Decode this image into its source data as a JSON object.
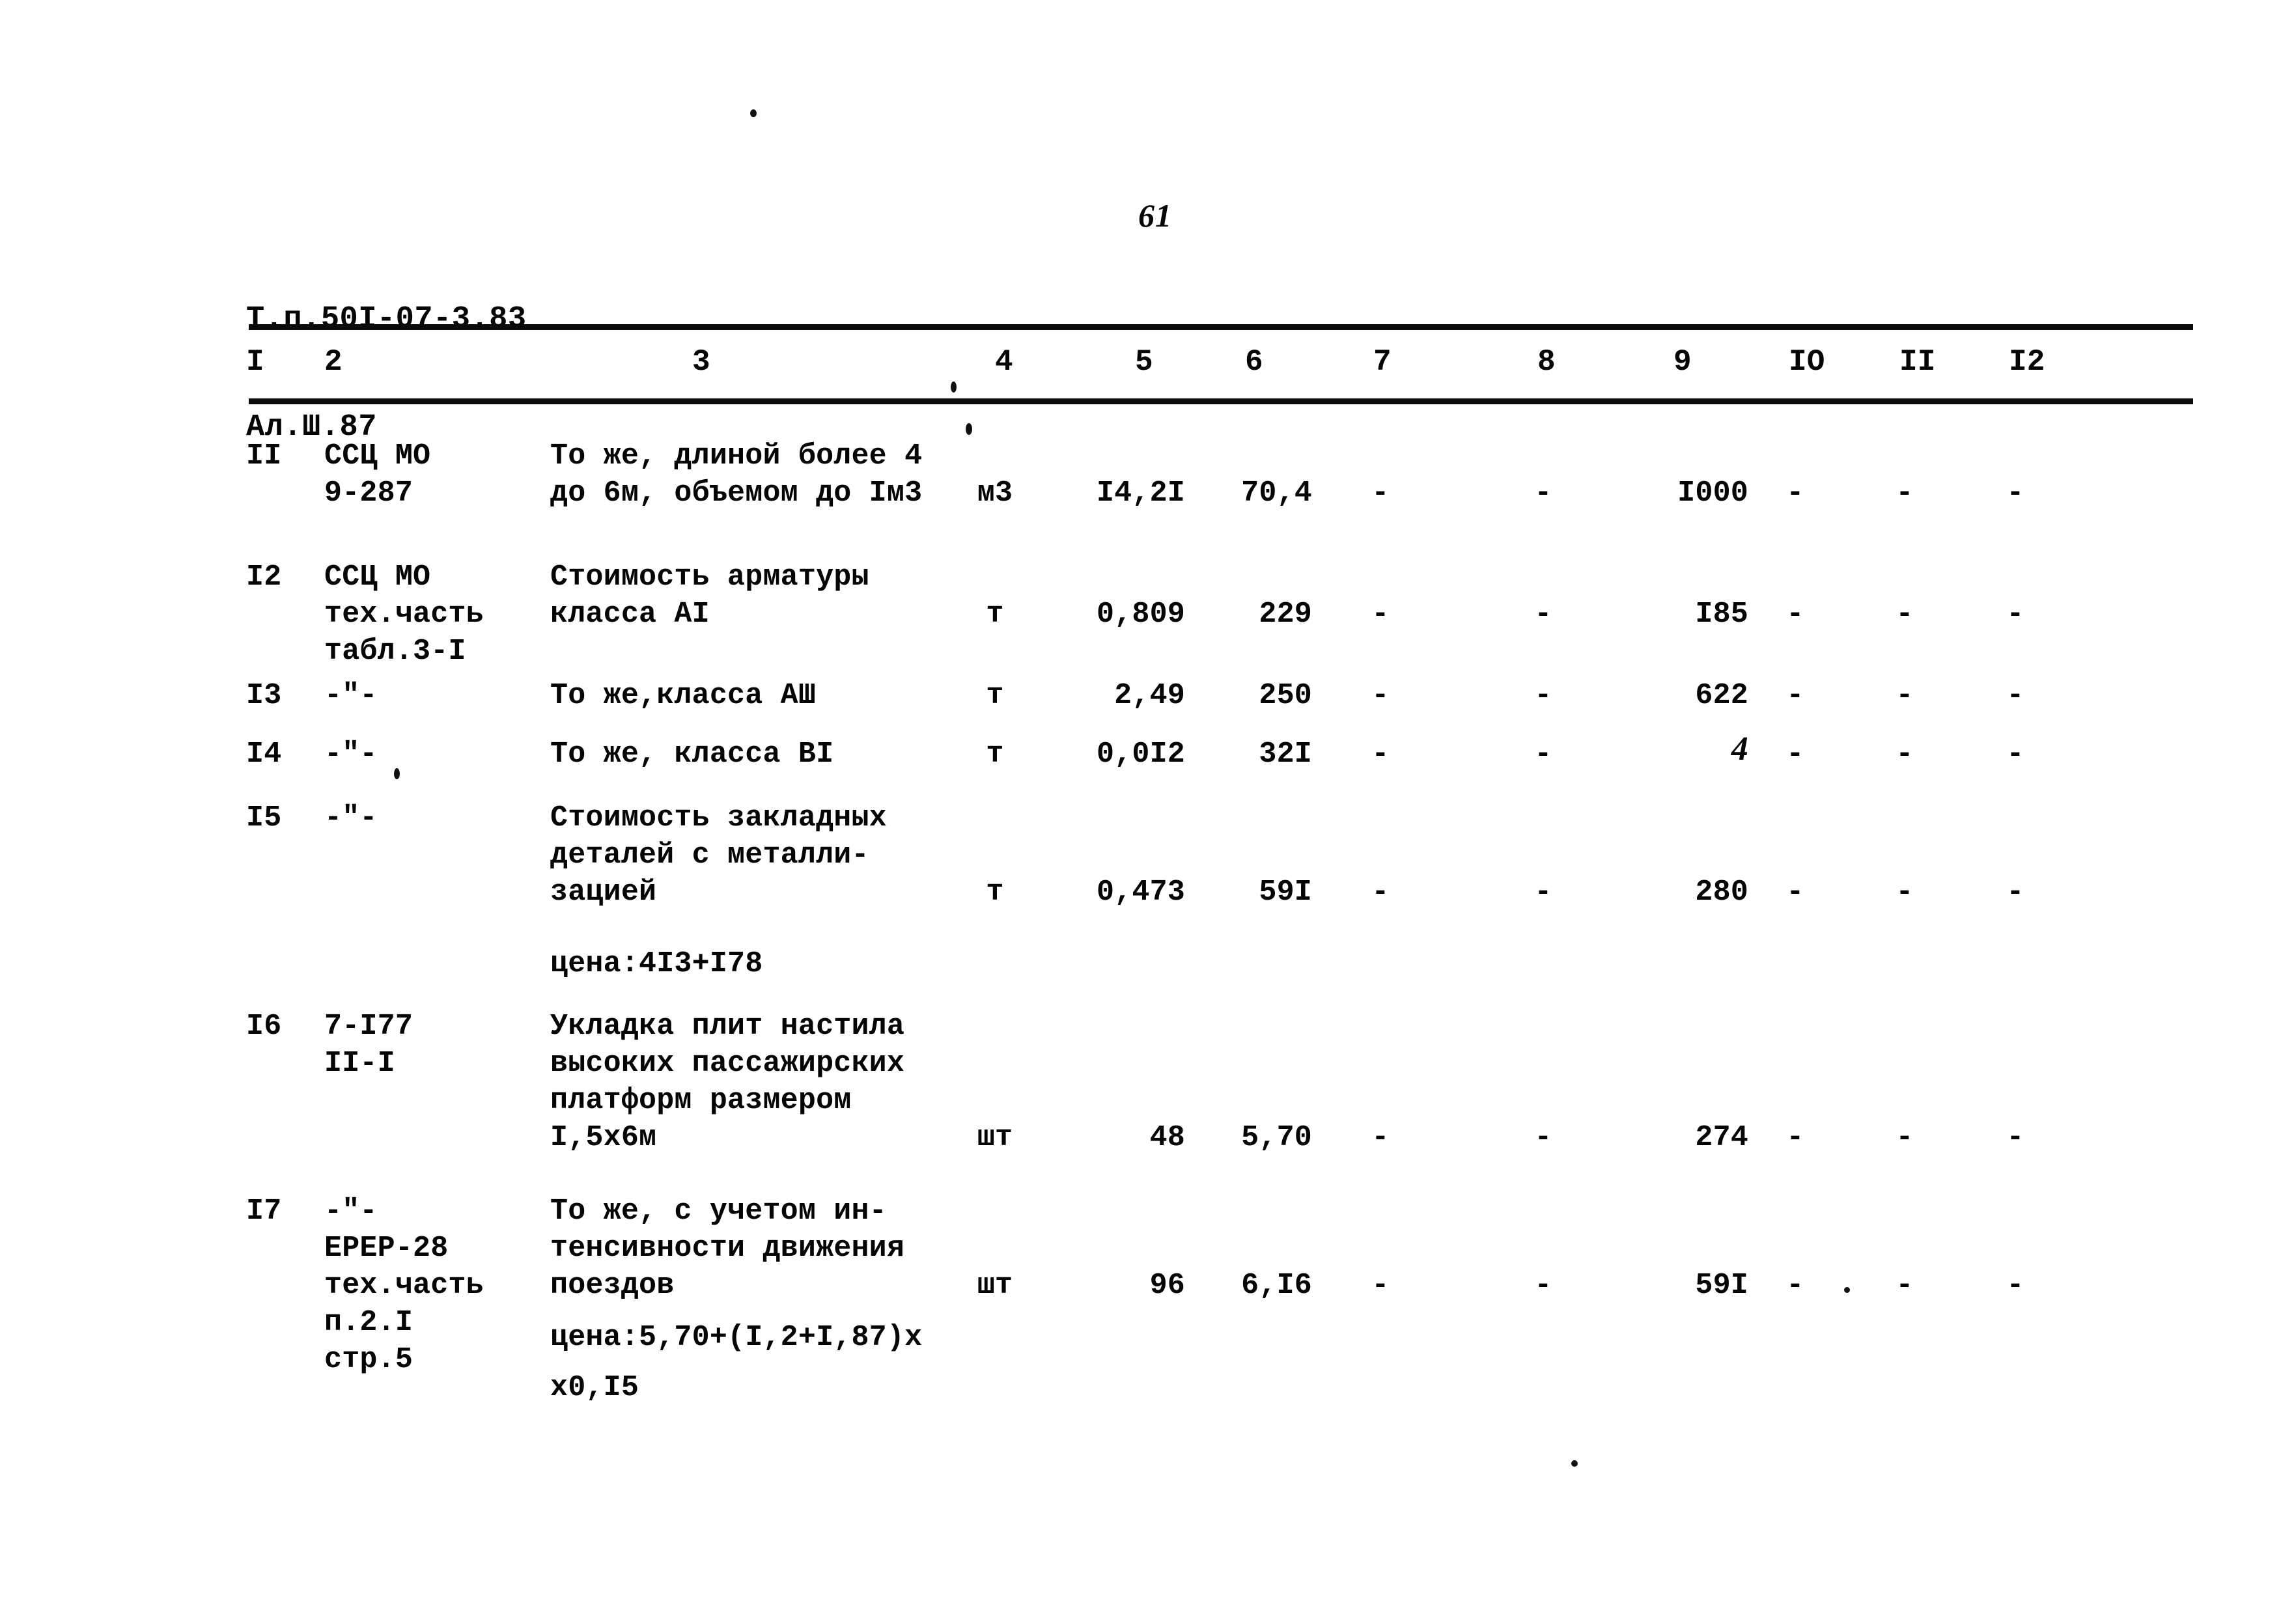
{
  "document": {
    "code_line1": "Т.п.50I-07-3.83",
    "code_line2": "Ал.Ш.87",
    "page_number": "61"
  },
  "table": {
    "column_headers": [
      "I",
      "2",
      "3",
      "4",
      "5",
      "6",
      "7",
      "8",
      "9",
      "IO",
      "II",
      "I2"
    ],
    "rows": [
      {
        "num": "II",
        "code": [
          "ССЦ МО",
          "9-287"
        ],
        "description": [
          "То же, длиной более 4",
          "до 6м, объемом до Iм3"
        ],
        "note": "",
        "unit": "м3",
        "qty": "I4,2I",
        "price": "70,4",
        "c7": "-",
        "c8": "-",
        "total": "I000",
        "c10": "-",
        "c11": "-",
        "c12": "-"
      },
      {
        "num": "I2",
        "code": [
          "ССЦ МО",
          "тех.часть",
          "табл.3-I"
        ],
        "description": [
          "Стоимость арматуры",
          "класса АI"
        ],
        "note": "",
        "unit": "т",
        "qty": "0,809",
        "price": "229",
        "c7": "-",
        "c8": "-",
        "total": "I85",
        "c10": "-",
        "c11": "-",
        "c12": "-"
      },
      {
        "num": "I3",
        "code": [
          "-\"-"
        ],
        "description": [
          "То же,класса АШ"
        ],
        "note": "",
        "unit": "т",
        "qty": "2,49",
        "price": "250",
        "c7": "-",
        "c8": "-",
        "total": "622",
        "c10": "-",
        "c11": "-",
        "c12": "-"
      },
      {
        "num": "I4",
        "code": [
          "-\"-"
        ],
        "description": [
          "То же, класса ВI"
        ],
        "note": "",
        "unit": "т",
        "qty": "0,0I2",
        "price": "32I",
        "c7": "-",
        "c8": "-",
        "total": "4",
        "c10": "-",
        "c11": "-",
        "c12": "-"
      },
      {
        "num": "I5",
        "code": [
          "-\"-"
        ],
        "description": [
          "Стоимость закладных",
          "деталей с металли-",
          "зацией"
        ],
        "note": "цена:4I3+I78",
        "unit": "т",
        "qty": "0,473",
        "price": "59I",
        "c7": "-",
        "c8": "-",
        "total": "280",
        "c10": "-",
        "c11": "-",
        "c12": "-"
      },
      {
        "num": "I6",
        "code": [
          "7-I77",
          "II-I"
        ],
        "description": [
          "Укладка плит настила",
          "высоких пассажирских",
          "платформ размером",
          "I,5х6м"
        ],
        "note": "",
        "unit": "шт",
        "qty": "48",
        "price": "5,70",
        "c7": "-",
        "c8": "-",
        "total": "274",
        "c10": "-",
        "c11": "-",
        "c12": "-"
      },
      {
        "num": "I7",
        "code": [
          "-\"-",
          "ЕРЕР-28",
          "тех.часть",
          "п.2.I",
          "стр.5"
        ],
        "description": [
          "То же, с учетом ин-",
          "тенсивности движения",
          "поездов"
        ],
        "note": "цена:5,70+(I,2+I,87)х",
        "note2": "х0,I5",
        "unit": "шт",
        "qty": "96",
        "price": "6,I6",
        "c7": "-",
        "c8": "-",
        "total": "59I",
        "c10": "-",
        "c11": "-",
        "c12": "-"
      }
    ]
  }
}
